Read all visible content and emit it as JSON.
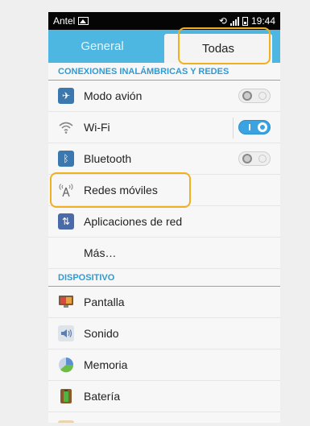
{
  "status_bar": {
    "carrier": "Antel",
    "time": "19:44"
  },
  "tabs": [
    {
      "label": "General"
    },
    {
      "label": "Todas"
    }
  ],
  "sections": {
    "wireless": "CONEXIONES INALÁMBRICAS Y REDES",
    "device": "DISPOSITIVO"
  },
  "wireless_items": [
    {
      "label": "Modo avión",
      "icon": "airplane-icon",
      "toggle": false
    },
    {
      "label": "Wi-Fi",
      "icon": "wifi-icon",
      "toggle": true
    },
    {
      "label": "Bluetooth",
      "icon": "bluetooth-icon",
      "toggle": false
    },
    {
      "label": "Redes móviles",
      "icon": "antenna-icon"
    },
    {
      "label": "Aplicaciones de red",
      "icon": "network-apps-icon"
    },
    {
      "label": "Más…"
    }
  ],
  "device_items": [
    {
      "label": "Pantalla",
      "icon": "display-icon"
    },
    {
      "label": "Sonido",
      "icon": "sound-icon"
    },
    {
      "label": "Memoria",
      "icon": "storage-icon"
    },
    {
      "label": "Batería",
      "icon": "battery-icon"
    }
  ],
  "colors": {
    "accent": "#4db7e1",
    "section_header": "#2d9bd6",
    "highlight": "#f0b020"
  }
}
